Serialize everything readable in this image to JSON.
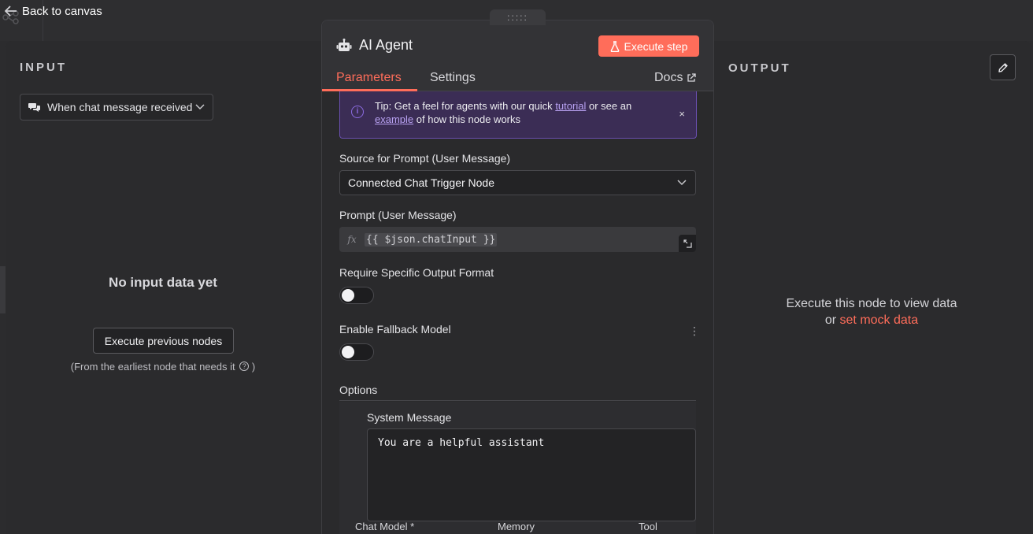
{
  "topbar": {
    "back_label": "Back to canvas"
  },
  "input_panel": {
    "title": "INPUT",
    "trigger_select": "When chat message received",
    "empty_title": "No input data yet",
    "execute_previous_label": "Execute previous nodes",
    "earliest_note": "(From the earliest node that needs it",
    "earliest_note_end": ")"
  },
  "output_panel": {
    "title": "OUTPUT",
    "message_line1": "Execute this node to view data",
    "message_or": "or",
    "mock_link": "set mock data"
  },
  "modal": {
    "drag_handle": ":::::",
    "node_title": "AI Agent",
    "execute_step_label": "Execute step",
    "tabs": {
      "parameters": "Parameters",
      "settings": "Settings",
      "docs": "Docs"
    },
    "tip": {
      "prefix": "Tip: Get a feel for agents with our quick",
      "link1": "tutorial",
      "middle": "or see an",
      "link2": "example",
      "suffix": "of how this node works",
      "close": "×"
    },
    "source_label": "Source for Prompt (User Message)",
    "source_value": "Connected Chat Trigger Node",
    "prompt_label": "Prompt (User Message)",
    "prompt_fx": "fx",
    "prompt_expression": "{{ $json.chatInput }}",
    "require_output_label": "Require Specific Output Format",
    "require_output_enabled": false,
    "fallback_label": "Enable Fallback Model",
    "fallback_enabled": false,
    "kebab": "⋮",
    "options_label": "Options",
    "system_message_label": "System Message",
    "system_message_value": "You are a helpful assistant",
    "bottom_tabs": [
      "Chat Model *",
      "Memory",
      "Tool"
    ]
  },
  "colors": {
    "accent": "#ff6d5a",
    "tip_bg": "#3b2d55",
    "tip_border": "#6b4fb0"
  }
}
